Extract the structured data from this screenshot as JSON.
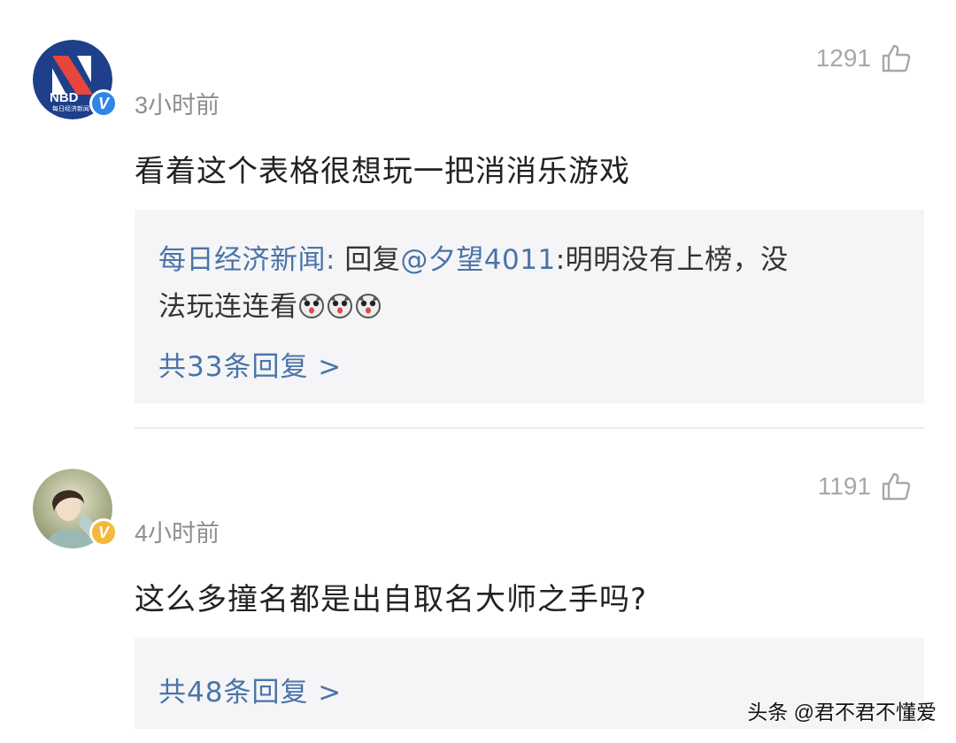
{
  "comments": [
    {
      "avatar_text": "NBD",
      "avatar_subtext": "每日经济新闻",
      "verified_badge": "V",
      "time": "3小时前",
      "likes": "1291",
      "text": "看着这个表格很想玩一把消消乐游戏",
      "reply": {
        "author": "每日经济新闻:",
        "reply_prefix": "回复",
        "mention": "@夕望4011",
        "line1_text": ":明明没有上榜，没",
        "line2_text": "法玩连连看"
      },
      "reply_count": "共33条回复 >"
    },
    {
      "verified_badge": "V",
      "time": "4小时前",
      "likes": "1191",
      "text": "这么多撞名都是出自取名大师之手吗?",
      "reply_count": "共48条回复 >"
    }
  ],
  "watermark": "头条 @君不君不懂爱",
  "colors": {
    "link_blue": "#4a74a8",
    "reply_bg": "#f5f5f7",
    "badge_blue": "#2f86e8",
    "badge_gold": "#f2b93b"
  },
  "icons": [
    "thumbs-up-icon",
    "verified-badge-icon",
    "dog-emoji-icon"
  ]
}
